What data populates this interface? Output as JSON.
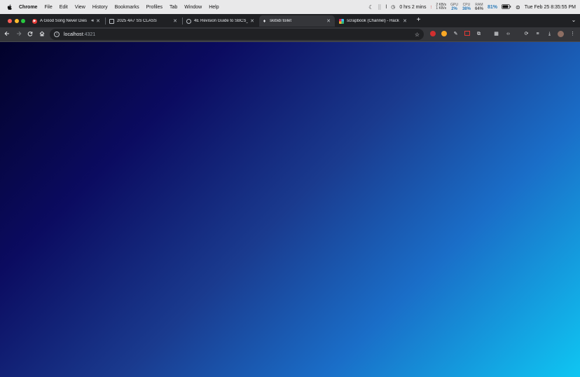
{
  "menubar": {
    "apple": "",
    "items": [
      "Chrome",
      "File",
      "Edit",
      "View",
      "History",
      "Bookmarks",
      "Profiles",
      "Tab",
      "Window",
      "Help"
    ],
    "timer": "0 hrs 2 mins",
    "net_up": "2 KB/s",
    "net_down": "1 KB/s",
    "gpu_label": "GPU",
    "gpu_value": "2%",
    "cpu_label": "CPU",
    "cpu_value": "38%",
    "ram_label": "RAM",
    "ram_value": "64%",
    "battery": "81%",
    "clock": "Tue Feb 25  8:35:55 PM"
  },
  "tabs": [
    {
      "title": "A Good Song Never Dies",
      "favicon_color": "#e53935"
    },
    {
      "title": "2025 4A7 SS CLASS",
      "favicon_color": "#9aa0a6"
    },
    {
      "title": "4E Revision Guide to SBCS_T",
      "favicon_color": "#9aa0a6"
    },
    {
      "title": "skibidi toilet",
      "favicon_color": "#bdc1c6"
    },
    {
      "title": "scrapbook (Channel) - Hack",
      "favicon_color": "#e01e5a"
    }
  ],
  "omnibox": {
    "host": "localhost",
    "port": ":4321"
  },
  "colors": {
    "gradient_start": "#02022a",
    "gradient_mid": "#0b0b60",
    "gradient_end": "#0fc6f2",
    "chrome_dark": "#202124",
    "chrome_toolbar": "#35363a"
  },
  "icons": {
    "back": "arrow-left-icon",
    "forward": "arrow-right-icon",
    "reload": "reload-icon",
    "home": "home-icon",
    "bookmark": "star-icon"
  }
}
